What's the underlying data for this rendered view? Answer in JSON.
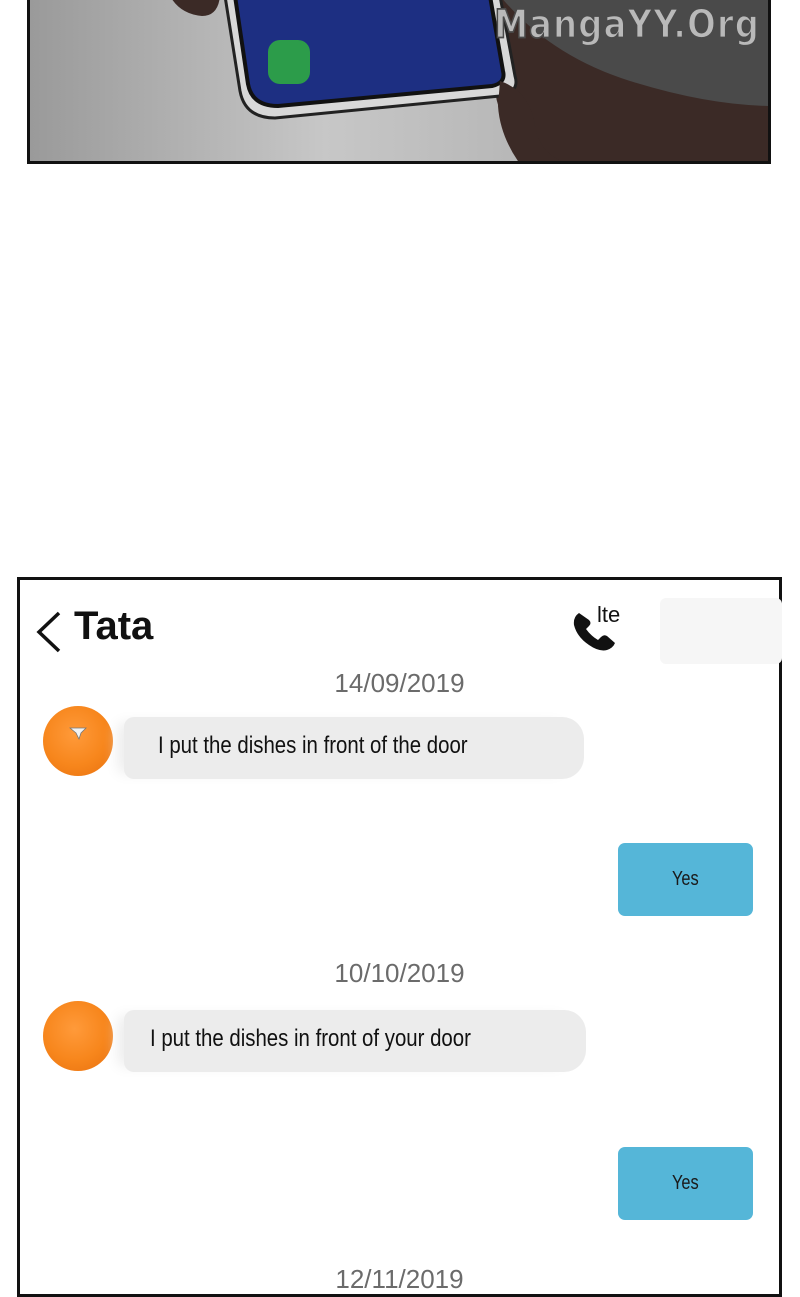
{
  "watermark": "MangaYY.Org",
  "chat": {
    "contact_name": "Tata",
    "network_label": "lte",
    "back_icon": "chevron-left-icon",
    "call_icon": "phone-icon",
    "conversations": [
      {
        "date": "14/09/2019",
        "incoming": "I put the dishes in front of the door",
        "reply": "Yes"
      },
      {
        "date": "10/10/2019",
        "incoming": "I put the dishes in front of your door",
        "reply": "Yes"
      },
      {
        "date": "12/11/2019"
      }
    ],
    "colors": {
      "avatar": "#f7861c",
      "incoming_bubble": "#ececec",
      "outgoing_bubble": "#55b6d8",
      "date_text": "#6b6b6b"
    }
  }
}
